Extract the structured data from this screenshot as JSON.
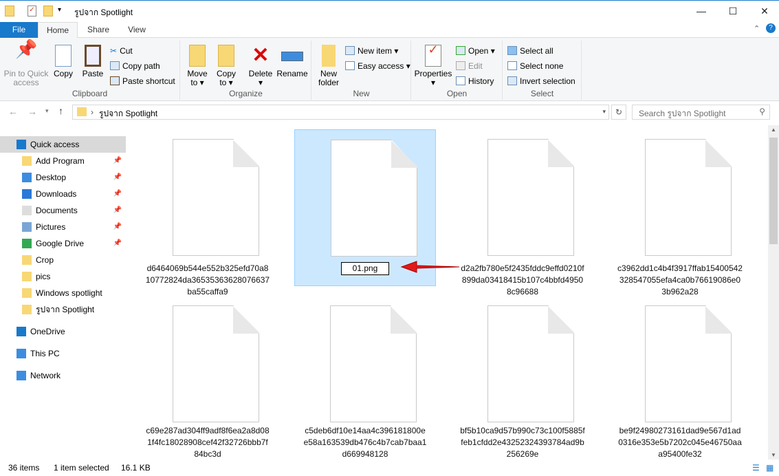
{
  "window": {
    "title": "รูปจาก Spotlight",
    "minimize": "—",
    "maximize": "☐",
    "close": "✕"
  },
  "tabs": [
    "File",
    "Home",
    "Share",
    "View"
  ],
  "ribbon": {
    "clipboard": {
      "label": "Clipboard",
      "pin": "Pin to Quick access",
      "copy": "Copy",
      "paste": "Paste",
      "cut": "Cut",
      "copy_path": "Copy path",
      "paste_shortcut": "Paste shortcut"
    },
    "organize": {
      "label": "Organize",
      "move_to": "Move to",
      "copy_to": "Copy to",
      "delete": "Delete",
      "rename": "Rename"
    },
    "new": {
      "label": "New",
      "new_folder": "New folder",
      "new_item": "New item",
      "easy_access": "Easy access"
    },
    "open": {
      "label": "Open",
      "properties": "Properties",
      "open": "Open",
      "edit": "Edit",
      "history": "History"
    },
    "select": {
      "label": "Select",
      "select_all": "Select all",
      "select_none": "Select none",
      "invert": "Invert selection"
    }
  },
  "address": {
    "path": "รูปจาก Spotlight",
    "search_placeholder": "Search รูปจาก Spotlight"
  },
  "sidebar": [
    {
      "label": "Quick access",
      "pinned": false
    },
    {
      "label": "Add Program",
      "pinned": true
    },
    {
      "label": "Desktop",
      "pinned": true
    },
    {
      "label": "Downloads",
      "pinned": true
    },
    {
      "label": "Documents",
      "pinned": true
    },
    {
      "label": "Pictures",
      "pinned": true
    },
    {
      "label": "Google Drive",
      "pinned": true
    },
    {
      "label": "Crop",
      "pinned": false
    },
    {
      "label": "pics",
      "pinned": false
    },
    {
      "label": "Windows spotlight",
      "pinned": false
    },
    {
      "label": "รูปจาก Spotlight",
      "pinned": false
    },
    {
      "label": "OneDrive",
      "pinned": false
    },
    {
      "label": "This PC",
      "pinned": false
    },
    {
      "label": "Network",
      "pinned": false
    }
  ],
  "files": [
    {
      "name": "d6464069b544e552b325efd70a810772824da36535363628076637ba55caffa9"
    },
    {
      "name": "01.png",
      "renaming": true
    },
    {
      "name": "d2a2fb780e5f2435fddc9effd0210f899da03418415b107c4bbfd49508c96688"
    },
    {
      "name": "c3962dd1c4b4f3917ffab15400542328547055efa4ca0b76619086e03b962a28"
    },
    {
      "name": "c69e287ad304ff9adf8f6ea2a8d081f4fc18028908cef42f32726bbb7f84bc3d"
    },
    {
      "name": "c5deb6df10e14aa4c396181800ee58a163539db476c4b7cab7baa1d669948128"
    },
    {
      "name": "bf5b10ca9d57b990c73c100f5885ffeb1cfdd2e43252324393784ad9b256269e"
    },
    {
      "name": "be9f24980273161dad9e567d1ad0316e353e5b7202c045e46750aaa95400fe32"
    }
  ],
  "status": {
    "count": "36 items",
    "selected": "1 item selected",
    "size": "16.1 KB"
  },
  "colors": {
    "accent": "#1979ca",
    "selection": "#cce8ff",
    "arrow": "#e11a1a"
  }
}
